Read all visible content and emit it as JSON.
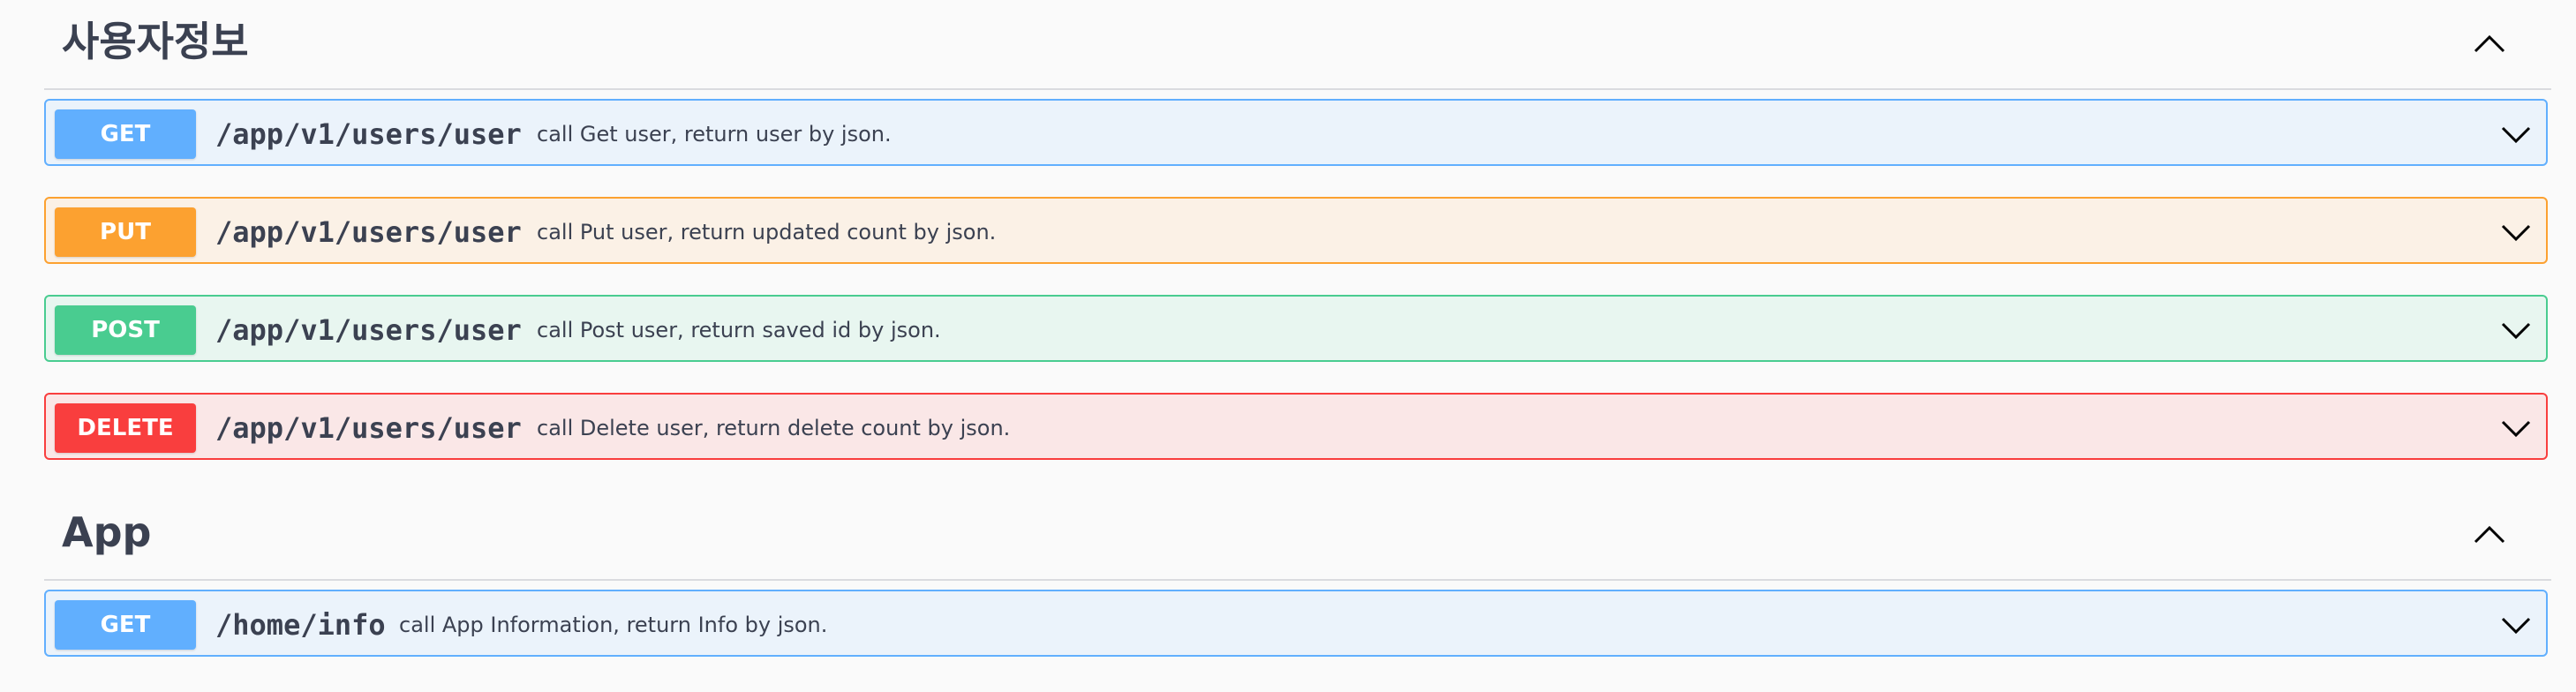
{
  "sections": [
    {
      "title": "사용자정보",
      "toggle_icon": "chevron-up-icon",
      "operations": [
        {
          "method": "GET",
          "path": "/app/v1/users/user",
          "summary": "call Get user, return user by json.",
          "color": "#61affe"
        },
        {
          "method": "PUT",
          "path": "/app/v1/users/user",
          "summary": "call Put user, return updated count by json.",
          "color": "#fca130"
        },
        {
          "method": "POST",
          "path": "/app/v1/users/user",
          "summary": "call Post user, return saved id by json.",
          "color": "#49cc90"
        },
        {
          "method": "DELETE",
          "path": "/app/v1/users/user",
          "summary": "call Delete user, return delete count by json.",
          "color": "#f93e3e"
        }
      ]
    },
    {
      "title": "App",
      "toggle_icon": "chevron-up-icon",
      "operations": [
        {
          "method": "GET",
          "path": "/home/info",
          "summary": "call App Information, return Info by json.",
          "color": "#61affe"
        }
      ]
    }
  ],
  "operation_toggle_icon": "chevron-down-icon"
}
